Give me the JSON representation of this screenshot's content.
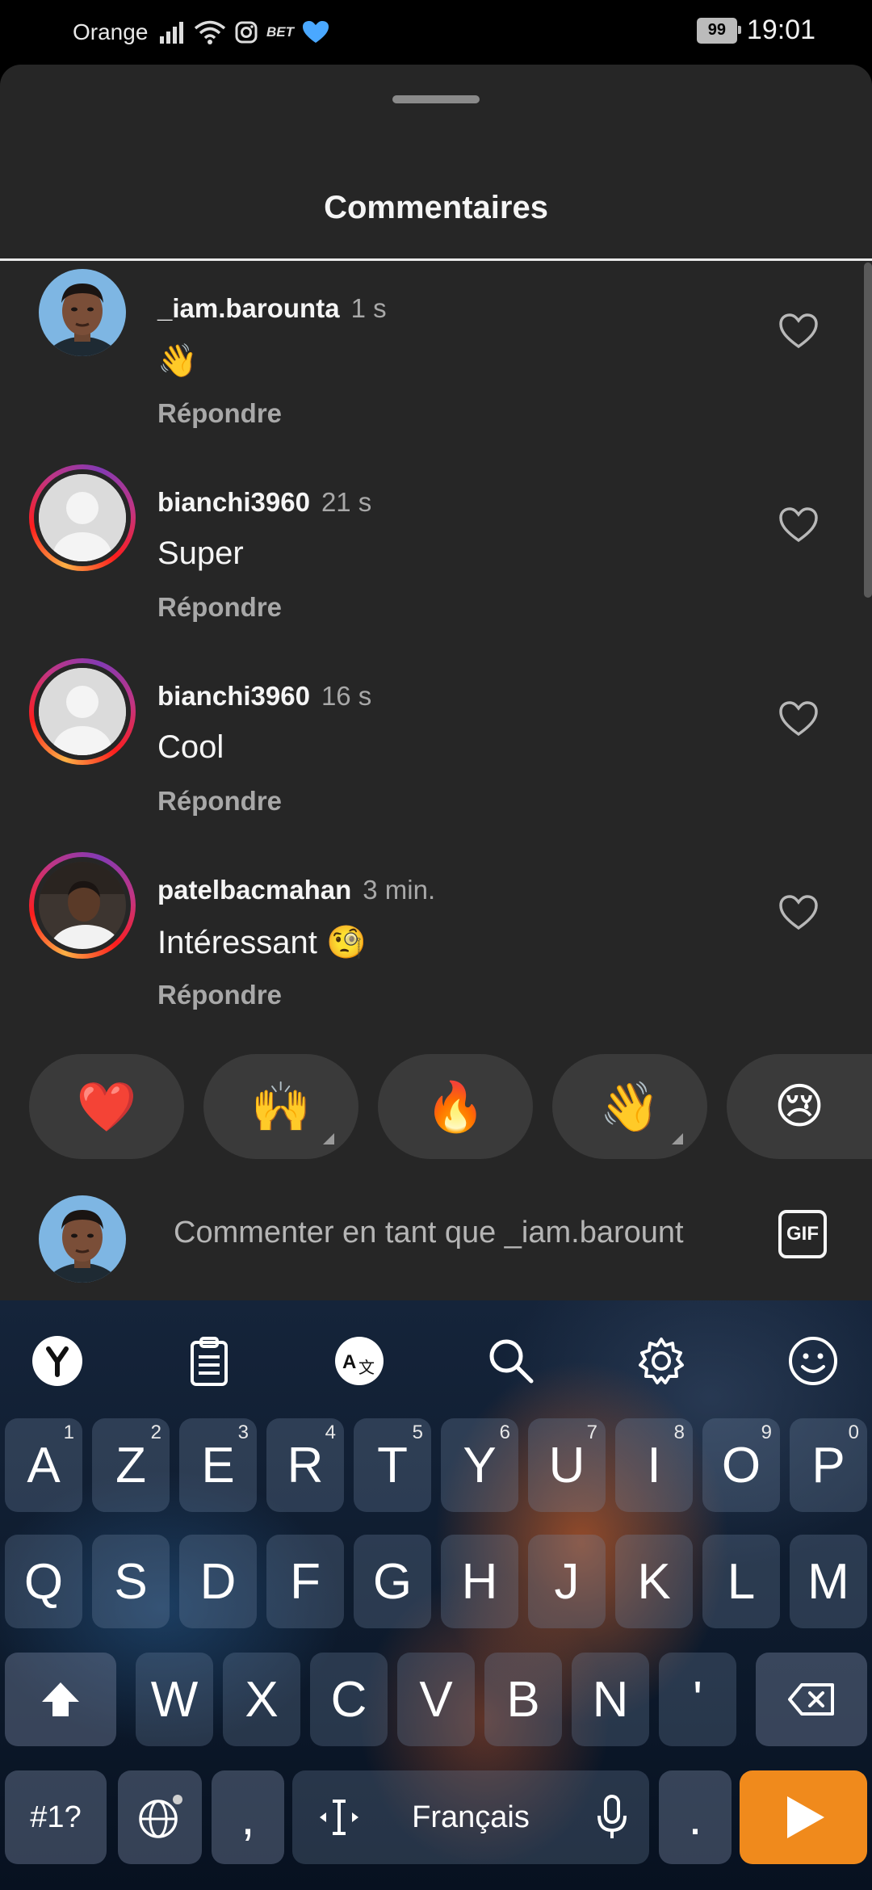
{
  "status_bar": {
    "carrier": "Orange",
    "battery": "99",
    "time": "19:01",
    "icons": [
      "signal-icon",
      "wifi-icon",
      "instagram-icon",
      "betwinner-icon",
      "heart-icon"
    ],
    "betwinner_text": "BET"
  },
  "sheet": {
    "title": "Commentaires"
  },
  "comments": [
    {
      "username": "_iam.barounta",
      "time": "1 s",
      "text": "👋",
      "reply": "Répondre",
      "avatar": "photo-man"
    },
    {
      "username": "bianchi3960",
      "time": "21 s",
      "text": "Super",
      "reply": "Répondre",
      "avatar": "default"
    },
    {
      "username": "bianchi3960",
      "time": "16 s",
      "text": "Cool",
      "reply": "Répondre",
      "avatar": "default"
    },
    {
      "username": "patelbacmahan",
      "time": "3 min.",
      "text": "Intéressant 🧐",
      "reply": "Répondre",
      "avatar": "photo-person"
    }
  ],
  "reactions": [
    "❤️",
    "🙌",
    "🔥",
    "👋",
    "😢"
  ],
  "comment_input": {
    "placeholder": "Commenter en tant que _iam.barount",
    "gif_label": "GIF"
  },
  "keyboard": {
    "row1": [
      {
        "k": "A",
        "n": "1"
      },
      {
        "k": "Z",
        "n": "2"
      },
      {
        "k": "E",
        "n": "3"
      },
      {
        "k": "R",
        "n": "4"
      },
      {
        "k": "T",
        "n": "5"
      },
      {
        "k": "Y",
        "n": "6"
      },
      {
        "k": "U",
        "n": "7"
      },
      {
        "k": "I",
        "n": "8"
      },
      {
        "k": "O",
        "n": "9"
      },
      {
        "k": "P",
        "n": "0"
      }
    ],
    "row2": [
      "Q",
      "S",
      "D",
      "F",
      "G",
      "H",
      "J",
      "K",
      "L",
      "M"
    ],
    "row3": [
      "W",
      "X",
      "C",
      "V",
      "B",
      "N",
      "'"
    ],
    "symbols_label": "#1?",
    "comma": ",",
    "space_label": "Français",
    "period": ".",
    "accent_color": "#f08a1c"
  }
}
